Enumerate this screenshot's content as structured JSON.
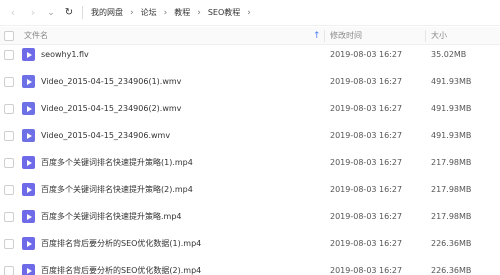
{
  "breadcrumb": {
    "items": [
      "我的网盘",
      "论坛",
      "教程",
      "SEO教程"
    ]
  },
  "columns": {
    "name": "文件名",
    "time": "修改时间",
    "size": "大小"
  },
  "files": [
    {
      "name": "seowhy1.flv",
      "time": "2019-08-03 16:27",
      "size": "35.02MB",
      "icon": "video-file-icon"
    },
    {
      "name": "Video_2015-04-15_234906(1).wmv",
      "time": "2019-08-03 16:27",
      "size": "491.93MB",
      "icon": "video-file-icon"
    },
    {
      "name": "Video_2015-04-15_234906(2).wmv",
      "time": "2019-08-03 16:27",
      "size": "491.93MB",
      "icon": "video-file-icon"
    },
    {
      "name": "Video_2015-04-15_234906.wmv",
      "time": "2019-08-03 16:27",
      "size": "491.93MB",
      "icon": "video-file-icon"
    },
    {
      "name": "百度多个关键词排名快速提升策略(1).mp4",
      "time": "2019-08-03 16:27",
      "size": "217.98MB",
      "icon": "video-file-icon"
    },
    {
      "name": "百度多个关键词排名快速提升策略(2).mp4",
      "time": "2019-08-03 16:27",
      "size": "217.98MB",
      "icon": "video-file-icon"
    },
    {
      "name": "百度多个关键词排名快速提升策略.mp4",
      "time": "2019-08-03 16:27",
      "size": "217.98MB",
      "icon": "video-file-icon"
    },
    {
      "name": "百度排名背后要分析的SEO优化数据(1).mp4",
      "time": "2019-08-03 16:27",
      "size": "226.36MB",
      "icon": "video-file-icon"
    },
    {
      "name": "百度排名背后要分析的SEO优化数据(2).mp4",
      "time": "2019-08-03 16:27",
      "size": "226.36MB",
      "icon": "video-file-icon"
    }
  ],
  "colors": {
    "icon": "#6f6be8",
    "sort_arrow": "#4a7ef2"
  }
}
